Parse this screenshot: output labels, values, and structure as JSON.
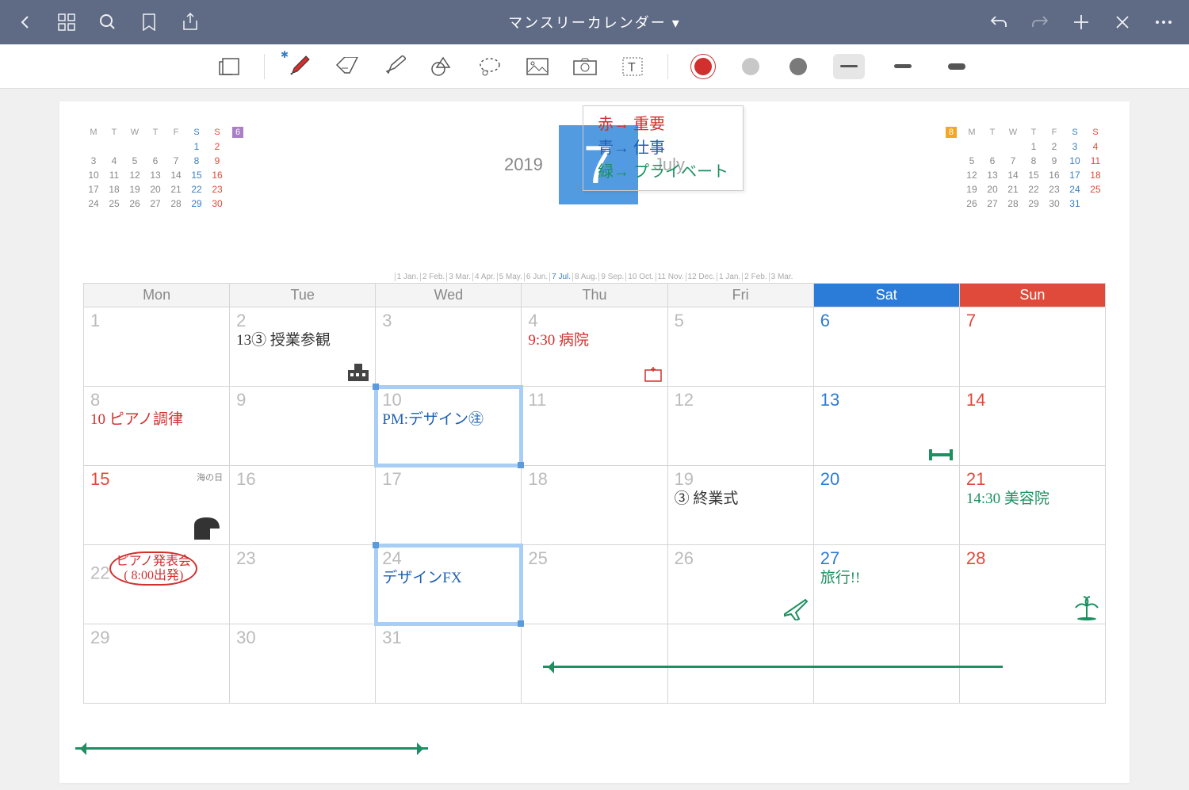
{
  "topbar": {
    "title": "マンスリーカレンダー ▾"
  },
  "header": {
    "year": "2019",
    "month_number": "7",
    "month_name": "July"
  },
  "legend": {
    "line1": "赤→ 重要",
    "line2": "青→ 仕事",
    "line3": "緑→ プライベート"
  },
  "mini_prev": {
    "badge": "6",
    "dow": [
      "M",
      "T",
      "W",
      "T",
      "F",
      "S",
      "S"
    ],
    "rows": [
      [
        "",
        "",
        "",
        "",
        "",
        "1",
        "2"
      ],
      [
        "3",
        "4",
        "5",
        "6",
        "7",
        "8",
        "9"
      ],
      [
        "10",
        "11",
        "12",
        "13",
        "14",
        "15",
        "16"
      ],
      [
        "17",
        "18",
        "19",
        "20",
        "21",
        "22",
        "23"
      ],
      [
        "24",
        "25",
        "26",
        "27",
        "28",
        "29",
        "30"
      ]
    ]
  },
  "mini_next": {
    "badge": "8",
    "dow": [
      "M",
      "T",
      "W",
      "T",
      "F",
      "S",
      "S"
    ],
    "rows": [
      [
        "",
        "",
        "",
        "1",
        "2",
        "3",
        "4"
      ],
      [
        "5",
        "6",
        "7",
        "8",
        "9",
        "10",
        "11"
      ],
      [
        "12",
        "13",
        "14",
        "15",
        "16",
        "17",
        "18"
      ],
      [
        "19",
        "20",
        "21",
        "22",
        "23",
        "24",
        "25"
      ],
      [
        "26",
        "27",
        "28",
        "29",
        "30",
        "31",
        ""
      ]
    ]
  },
  "month_strip": [
    "1 Jan.",
    "2 Feb.",
    "3 Mar.",
    "4 Apr.",
    "5 May.",
    "6 Jun.",
    "7 Jul.",
    "8 Aug.",
    "9 Sep.",
    "10 Oct.",
    "11 Nov.",
    "12 Dec.",
    "1 Jan.",
    "2 Feb.",
    "3 Mar."
  ],
  "month_strip_current_index": 6,
  "dow_headers": [
    "Mon",
    "Tue",
    "Wed",
    "Thu",
    "Fri",
    "Sat",
    "Sun"
  ],
  "days": [
    {
      "n": "1"
    },
    {
      "n": "2",
      "note": "13③ 授業参観",
      "color": "black",
      "icon": "school"
    },
    {
      "n": "3"
    },
    {
      "n": "4",
      "note": "9:30 病院",
      "color": "red",
      "icon": "hospital"
    },
    {
      "n": "5"
    },
    {
      "n": "6",
      "sat": true
    },
    {
      "n": "7",
      "sun": true
    },
    {
      "n": "8",
      "note": "10 ピアノ調律",
      "color": "red"
    },
    {
      "n": "9"
    },
    {
      "n": "10",
      "note": "PM:デザイン㊟",
      "color": "blue",
      "selected": true
    },
    {
      "n": "11"
    },
    {
      "n": "12"
    },
    {
      "n": "13",
      "sat": true,
      "icon": "gym"
    },
    {
      "n": "14",
      "sun": true
    },
    {
      "n": "15",
      "holiday": "海の日",
      "icon": "piano"
    },
    {
      "n": "16"
    },
    {
      "n": "17"
    },
    {
      "n": "18"
    },
    {
      "n": "19",
      "note": "③ 終業式",
      "color": "black"
    },
    {
      "n": "20",
      "sat": true
    },
    {
      "n": "21",
      "sun": true,
      "note": "14:30 美容院",
      "color": "green"
    },
    {
      "n": "22",
      "note": "ピアノ発表会\n( 8:00出発)",
      "color": "red",
      "bubble": true
    },
    {
      "n": "23"
    },
    {
      "n": "24",
      "note": "デザインFX",
      "color": "blue",
      "selected": true,
      "wavy": true
    },
    {
      "n": "25"
    },
    {
      "n": "26",
      "icon": "plane"
    },
    {
      "n": "27",
      "sat": true,
      "note": "旅行!!",
      "color": "green"
    },
    {
      "n": "28",
      "sun": true,
      "icon": "palm"
    },
    {
      "n": "29"
    },
    {
      "n": "30"
    },
    {
      "n": "31"
    },
    {
      "n": ""
    },
    {
      "n": ""
    },
    {
      "n": ""
    },
    {
      "n": ""
    }
  ]
}
